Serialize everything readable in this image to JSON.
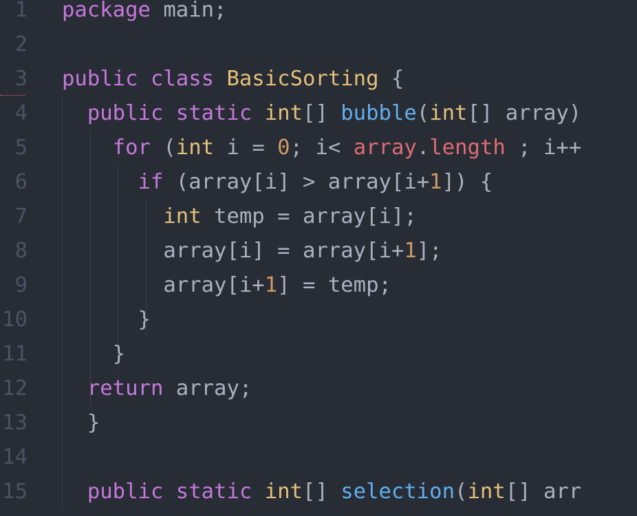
{
  "editor": {
    "colors": {
      "background": "#282c34",
      "keyword": "#c678dd",
      "type": "#e5c07b",
      "function": "#61afef",
      "plain": "#abb2bf",
      "number": "#d19a66",
      "property": "#e06c75",
      "line_number": "#4b5263"
    },
    "lines": [
      {
        "n": "1",
        "tokens": [
          {
            "t": "package",
            "c": "kw"
          },
          {
            "t": " main;",
            "c": "pl"
          }
        ]
      },
      {
        "n": "2",
        "tokens": []
      },
      {
        "n": "3",
        "tokens": [
          {
            "t": "public",
            "c": "kw"
          },
          {
            "t": " ",
            "c": "pl"
          },
          {
            "t": "class",
            "c": "kw"
          },
          {
            "t": " ",
            "c": "pl"
          },
          {
            "t": "BasicSorting",
            "c": "ty"
          },
          {
            "t": " {",
            "c": "pl"
          }
        ]
      },
      {
        "n": "4",
        "tokens": [
          {
            "t": "  ",
            "c": "pl"
          },
          {
            "t": "public",
            "c": "kw"
          },
          {
            "t": " ",
            "c": "pl"
          },
          {
            "t": "static",
            "c": "kw"
          },
          {
            "t": " ",
            "c": "pl"
          },
          {
            "t": "int",
            "c": "ty"
          },
          {
            "t": "[] ",
            "c": "pl"
          },
          {
            "t": "bubble",
            "c": "fn"
          },
          {
            "t": "(",
            "c": "pl"
          },
          {
            "t": "int",
            "c": "ty"
          },
          {
            "t": "[] array)",
            "c": "pl"
          }
        ]
      },
      {
        "n": "5",
        "tokens": [
          {
            "t": "    ",
            "c": "pl"
          },
          {
            "t": "for",
            "c": "kw"
          },
          {
            "t": " (",
            "c": "pl"
          },
          {
            "t": "int",
            "c": "ty"
          },
          {
            "t": " i = ",
            "c": "pl"
          },
          {
            "t": "0",
            "c": "nu"
          },
          {
            "t": "; i< ",
            "c": "pl"
          },
          {
            "t": "array",
            "c": "pr"
          },
          {
            "t": ".",
            "c": "pl"
          },
          {
            "t": "length",
            "c": "pr"
          },
          {
            "t": " ; i++",
            "c": "pl"
          }
        ]
      },
      {
        "n": "6",
        "tokens": [
          {
            "t": "      ",
            "c": "pl"
          },
          {
            "t": "if",
            "c": "kw"
          },
          {
            "t": " (array[i] > array[i+",
            "c": "pl"
          },
          {
            "t": "1",
            "c": "nu"
          },
          {
            "t": "]) {",
            "c": "pl"
          }
        ]
      },
      {
        "n": "7",
        "tokens": [
          {
            "t": "        ",
            "c": "pl"
          },
          {
            "t": "int",
            "c": "ty"
          },
          {
            "t": " temp = array[i];",
            "c": "pl"
          }
        ]
      },
      {
        "n": "8",
        "tokens": [
          {
            "t": "        array[i] = array[i+",
            "c": "pl"
          },
          {
            "t": "1",
            "c": "nu"
          },
          {
            "t": "];",
            "c": "pl"
          }
        ]
      },
      {
        "n": "9",
        "tokens": [
          {
            "t": "        array[i+",
            "c": "pl"
          },
          {
            "t": "1",
            "c": "nu"
          },
          {
            "t": "] = temp;",
            "c": "pl"
          }
        ]
      },
      {
        "n": "10",
        "tokens": [
          {
            "t": "      }",
            "c": "pl"
          }
        ]
      },
      {
        "n": "11",
        "tokens": [
          {
            "t": "    }",
            "c": "pl"
          }
        ]
      },
      {
        "n": "12",
        "tokens": [
          {
            "t": "  ",
            "c": "pl"
          },
          {
            "t": "return",
            "c": "kw"
          },
          {
            "t": " array;",
            "c": "pl"
          }
        ]
      },
      {
        "n": "13",
        "tokens": [
          {
            "t": "  }",
            "c": "pl"
          }
        ]
      },
      {
        "n": "14",
        "tokens": []
      },
      {
        "n": "15",
        "tokens": [
          {
            "t": "  ",
            "c": "pl"
          },
          {
            "t": "public",
            "c": "kw"
          },
          {
            "t": " ",
            "c": "pl"
          },
          {
            "t": "static",
            "c": "kw"
          },
          {
            "t": " ",
            "c": "pl"
          },
          {
            "t": "int",
            "c": "ty"
          },
          {
            "t": "[] ",
            "c": "pl"
          },
          {
            "t": "selection",
            "c": "fn"
          },
          {
            "t": "(",
            "c": "pl"
          },
          {
            "t": "int",
            "c": "ty"
          },
          {
            "t": "[] arr",
            "c": "pl"
          }
        ]
      }
    ]
  }
}
